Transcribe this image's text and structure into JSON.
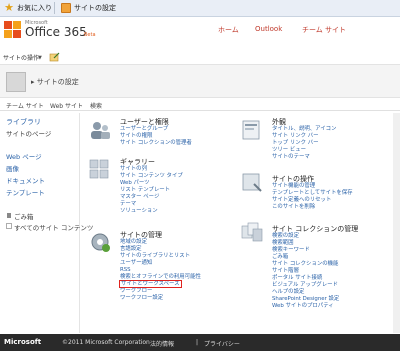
{
  "browser": {
    "favorites_label": "お気に入り",
    "tab_title": "サイトの設定"
  },
  "header": {
    "ms_label": "Microsoft",
    "product": "Office 365",
    "beta": "Beta",
    "nav": [
      "ホーム",
      "Outlook",
      "チーム サイト"
    ]
  },
  "actions": {
    "site_actions": "サイトの操作"
  },
  "page": {
    "title": "サイトの設定"
  },
  "linkbar": [
    "チーム サイト",
    "Web サイト",
    "検索"
  ],
  "leftnav": {
    "libraries": "ライブラリ",
    "site_pages": "サイトのページ",
    "web_page": "Web ページ",
    "images": "画像",
    "documents": "ドキュメント",
    "templates": "テンプレート",
    "recycle": "ごみ箱",
    "all_content": "すべてのサイト コンテンツ"
  },
  "sections": {
    "users": {
      "title": "ユーザーと権限",
      "links": [
        "ユーザーとグループ",
        "サイトの権限",
        "サイト コレクションの管理者"
      ]
    },
    "gallery": {
      "title": "ギャラリー",
      "links": [
        "サイトの列",
        "サイト コンテンツ タイプ",
        "Web パーツ",
        "リスト テンプレート",
        "マスター ページ",
        "テーマ",
        "ソリューション"
      ]
    },
    "site_admin": {
      "title": "サイトの管理",
      "links": [
        "地域の設定",
        "言語設定",
        "サイトのライブラリとリスト",
        "ユーザー通知",
        "RSS",
        "検索とオフラインでの利用可能性",
        "サイトとワークスペース",
        "ワークフロー",
        "ワークフロー設定"
      ]
    },
    "look": {
      "title": "外観",
      "links": [
        "タイトル、説明、アイコン",
        "サイト リンク バー",
        "トップ リンク バー",
        "ツリー ビュー",
        "サイトのテーマ"
      ]
    },
    "actions": {
      "title": "サイトの操作",
      "links": [
        "サイト機能の管理",
        "テンプレートとしてサイトを保存",
        "サイト定義へのリセット",
        "このサイトを削除"
      ]
    },
    "collection": {
      "title": "サイト コレクションの管理",
      "links": [
        "検索の設定",
        "検索範囲",
        "検索キーワード",
        "ごみ箱",
        "サイト コレクションの機能",
        "サイト階層",
        "ポータル サイト接続",
        "ビジュアル アップグレード",
        "ヘルプの設定",
        "SharePoint Designer 設定",
        "Web サイトのプロパティ"
      ]
    }
  },
  "footer": {
    "logo": "Microsoft",
    "copyright": "©2011 Microsoft Corporation",
    "legal": "法的情報",
    "privacy": "プライバシー"
  },
  "colors": {
    "accent": "#c0392b",
    "link": "#2a62a8",
    "highlight": "#e0231f",
    "footer_bg": "#2a2a2a"
  }
}
